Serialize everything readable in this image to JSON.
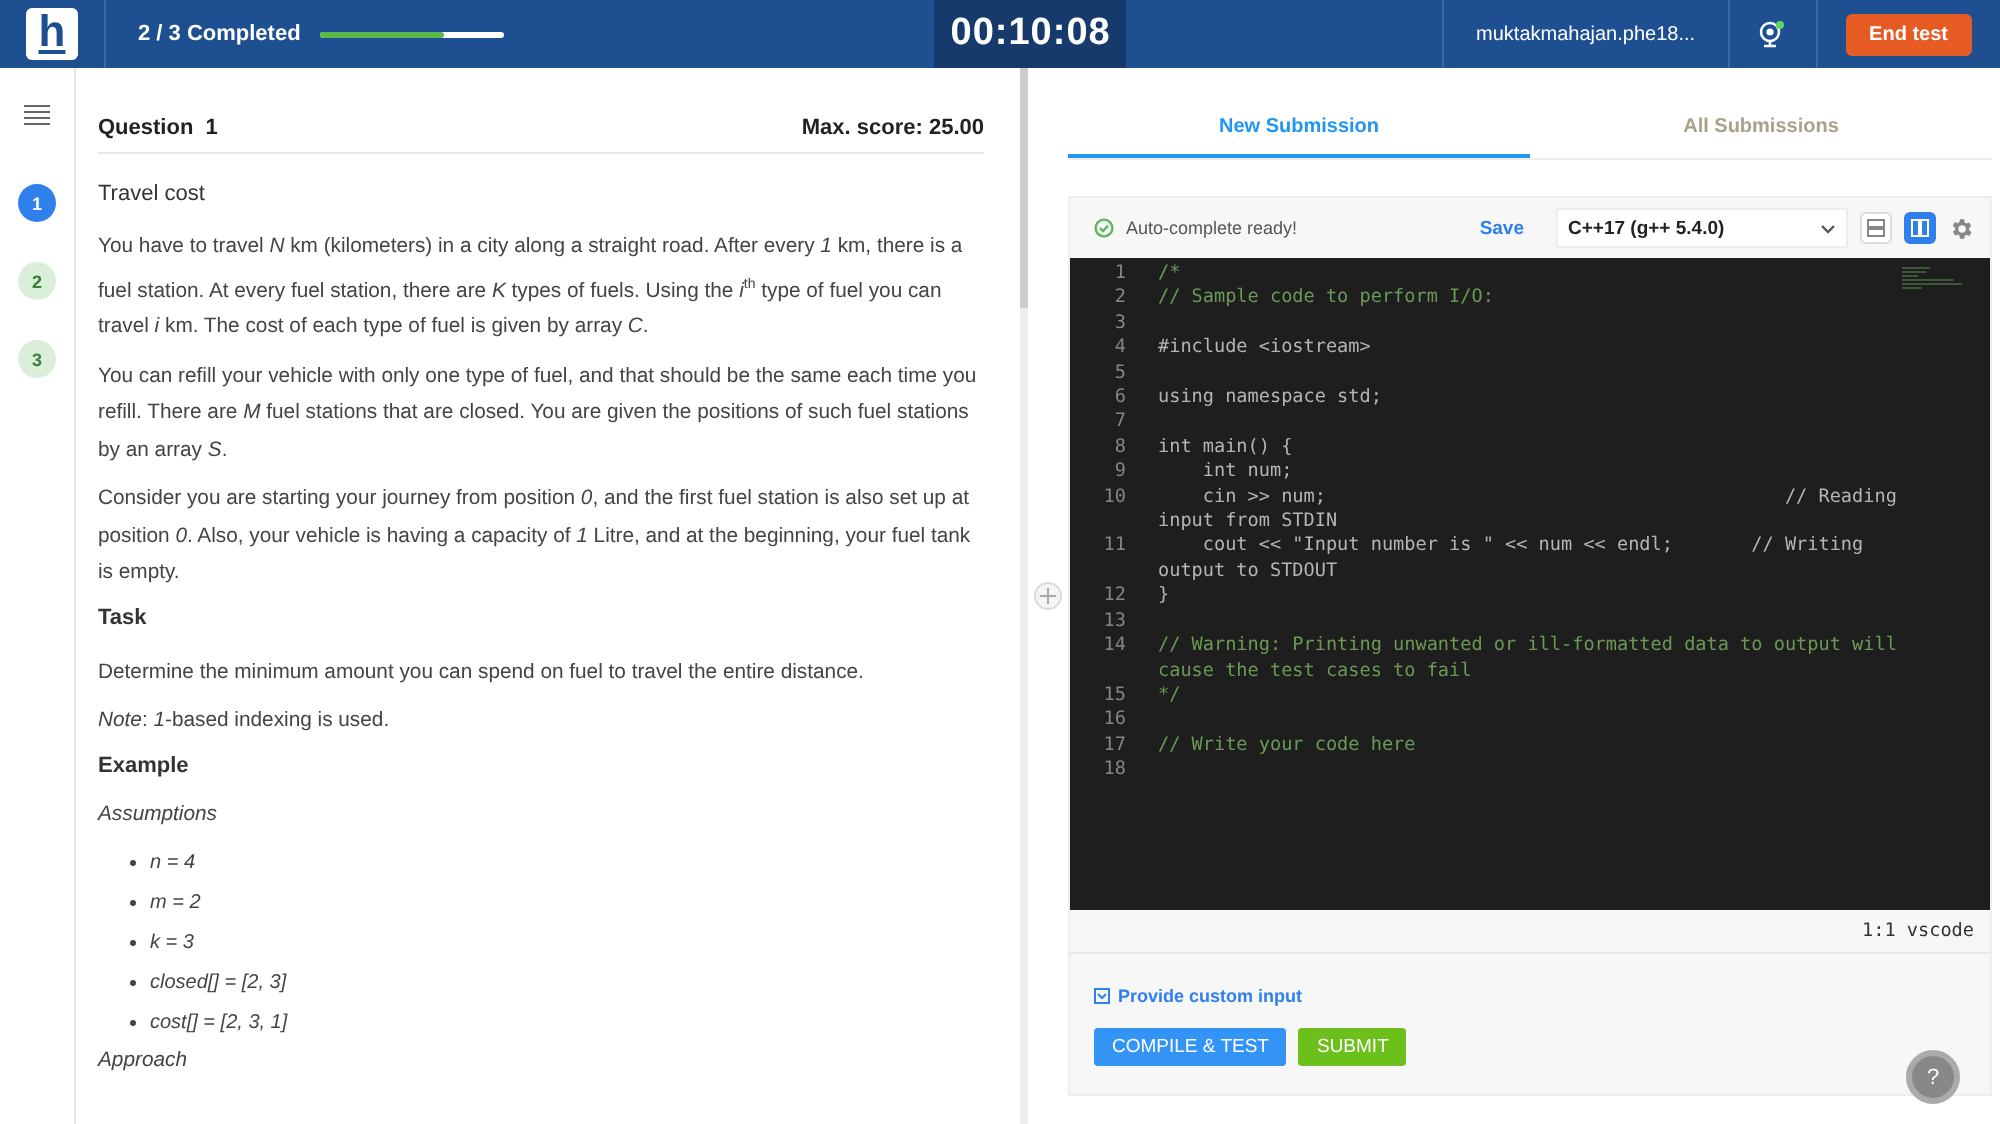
{
  "header": {
    "logo": "h",
    "progress_text": "2 / 3 Completed",
    "progress": {
      "level": 0.67
    },
    "timer": "00:10:08",
    "user": "muktakmahajan.phe18...",
    "end_button": "End test"
  },
  "question_nav": [
    {
      "label": "1",
      "selected": true
    },
    {
      "label": "2",
      "selected": false
    },
    {
      "label": "3",
      "selected": false
    }
  ],
  "question": {
    "title": "Question  1",
    "max_score": "Max. score: 25.00",
    "name": "Travel cost",
    "blocks": [
      {
        "kind": "para",
        "text": "You have to travel *N* km (kilometers) in a city along a straight road. After every *1* km, there is a fuel station. At every fuel station, there are *K* types of fuels. Using the *i*$^{th}$ type of fuel you can travel *i* km. The cost of each type of fuel is given by array *C*."
      },
      {
        "kind": "para",
        "text": "You can refill your vehicle with only one type of fuel, and that should be the same each time you refill. There are *M* fuel stations that are closed. You are given the positions of such fuel stations by an array *S*."
      },
      {
        "kind": "para",
        "text": "Consider you are starting your journey from position *0*, and the first fuel station is also set up at position *0*. Also, your vehicle is having a capacity of *1* Litre, and at the beginning, your fuel tank is empty."
      },
      {
        "kind": "heading",
        "text": "Task"
      },
      {
        "kind": "para",
        "text": "Determine the minimum amount you can spend on fuel to travel the entire distance."
      },
      {
        "kind": "para",
        "text": "*Note*: *1*-based indexing is used."
      },
      {
        "kind": "heading",
        "text": "Example"
      },
      {
        "kind": "subheading",
        "text": "Assumptions"
      },
      {
        "kind": "bullet",
        "text": "n = 4"
      },
      {
        "kind": "bullet",
        "text": "m = 2"
      },
      {
        "kind": "bullet",
        "text": "k = 3"
      },
      {
        "kind": "bullet",
        "text": "closed[] = [2, 3]"
      },
      {
        "kind": "bullet",
        "text": "cost[] = [2, 3, 1]"
      },
      {
        "kind": "subheading",
        "text": "Approach"
      }
    ]
  },
  "tabs": [
    {
      "label": "New Submission",
      "selected": true
    },
    {
      "label": "All Submissions",
      "selected": false
    }
  ],
  "editor": {
    "status": "Auto-complete ready!",
    "save": "Save",
    "language": "C++17 (g++ 5.4.0)",
    "layout_buttons": [
      {
        "kind": "stacked",
        "selected": false
      },
      {
        "kind": "split",
        "selected": true
      }
    ],
    "lines": [
      {
        "number": "1",
        "code": "/*"
      },
      {
        "number": "2",
        "code": "// Sample code to perform I/O:"
      },
      {
        "number": "3"
      },
      {
        "number": "4",
        "code": "#include <iostream>"
      },
      {
        "number": "5"
      },
      {
        "number": "6",
        "code": "using namespace std;"
      },
      {
        "number": "7"
      },
      {
        "number": "8",
        "code": "int main() {"
      },
      {
        "number": "9",
        "code": "    int num;"
      },
      {
        "number": "10",
        "code": "    cin >> num;                                         // Reading input from STDIN"
      },
      {
        "number": "11",
        "code": "    cout << \"Input number is \" << num << endl;       // Writing output to STDOUT"
      },
      {
        "number": "12",
        "code": "}"
      },
      {
        "number": "13"
      },
      {
        "number": "14",
        "code": "// Warning: Printing unwanted or ill-formatted data to output will cause the test cases to fail"
      },
      {
        "number": "15",
        "code": "*/"
      },
      {
        "number": "16"
      },
      {
        "number": "17",
        "code": "// Write your code here"
      },
      {
        "number": "18"
      }
    ],
    "cursor_status": "1:1 vscode"
  },
  "custom_input": "Provide custom input",
  "buttons": [
    {
      "kind": "compile",
      "label": "COMPILE & TEST"
    },
    {
      "kind": "submit",
      "label": "SUBMIT"
    }
  ],
  "help": "?"
}
